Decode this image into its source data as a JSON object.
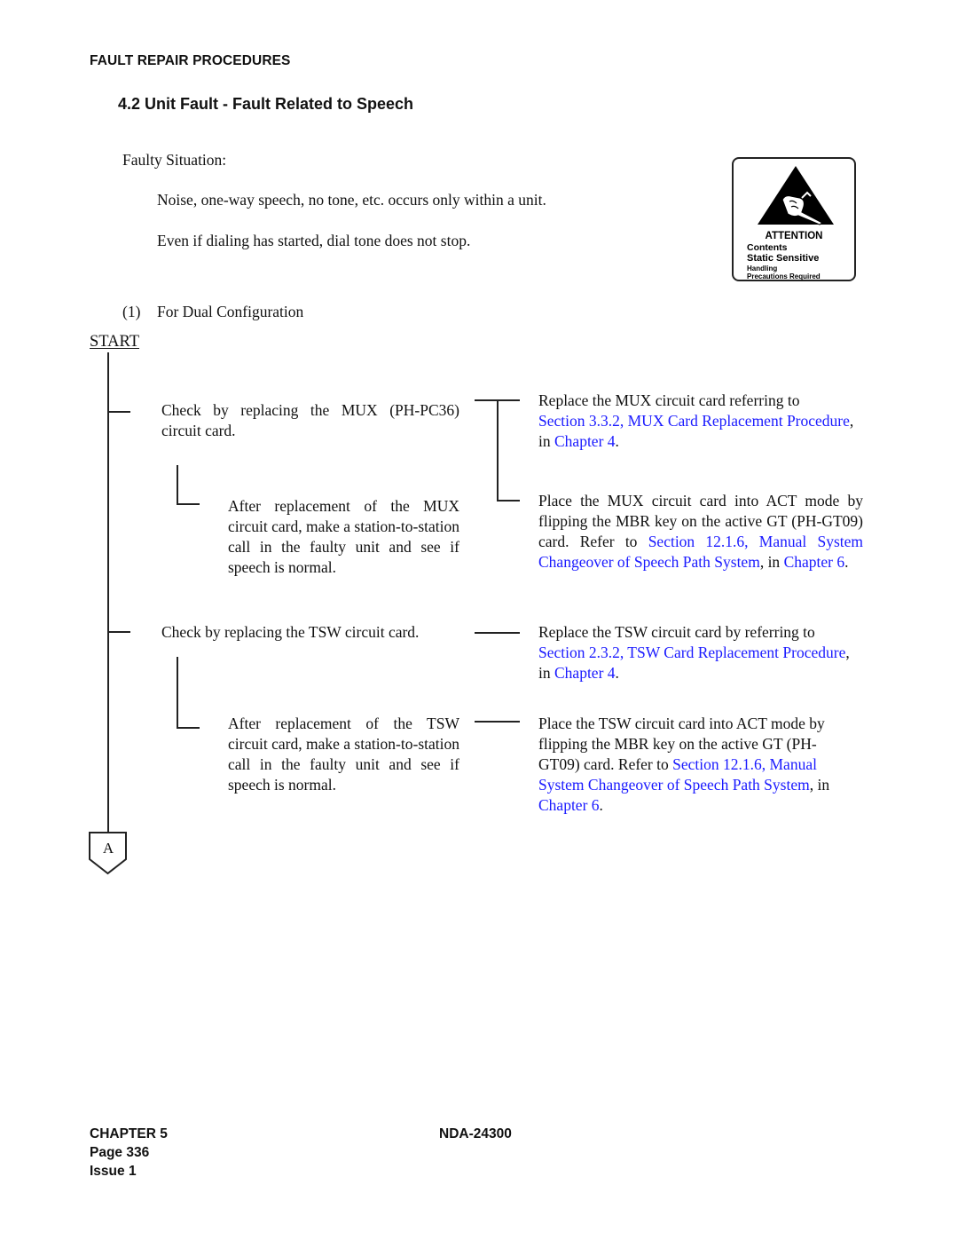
{
  "header": {
    "running_title": "FAULT REPAIR PROCEDURES"
  },
  "section": {
    "title": "4.2  Unit Fault - Fault Related to Speech"
  },
  "faulty_situation": {
    "label": "Faulty Situation:",
    "items": [
      "Noise, one-way speech, no tone, etc. occurs only within a unit.",
      "Even if dialing has started, dial tone does not stop."
    ]
  },
  "attention_badge": {
    "icon": "static-sensitive-hand-icon",
    "title": "ATTENTION",
    "line1": "Contents",
    "line2": "Static Sensitive",
    "line3": "Handling",
    "line4": "Precautions Required"
  },
  "config": {
    "number": "(1)",
    "label": "For Dual Configuration"
  },
  "flowchart": {
    "start_label": "START",
    "end_connector": "A",
    "steps": [
      {
        "check": "Check by replacing the MUX (PH-PC36) circuit card.",
        "after": "After replacement of the MUX circuit card, make a station-to-station call in the faulty unit and see if speech is normal.",
        "replace": {
          "prefix": "Replace the MUX circuit card referring to",
          "link1": "Section 3.3.2, MUX Card Replacement Procedure",
          "mid": ", in ",
          "link2": "Chapter 4",
          "suffix": "."
        },
        "place": {
          "prefix": "Place the MUX circuit card into ACT mode by flipping the MBR key on the active GT (PH-GT09) card. Refer to ",
          "link1": "Section 12.1.6, Manual System Changeover of Speech Path System",
          "mid": ", in ",
          "link2": "Chapter 6",
          "suffix": "."
        }
      },
      {
        "check": "Check by replacing the TSW circuit card.",
        "after": "After replacement of the TSW circuit card, make a station-to-station call in the faulty unit and see if speech is normal.",
        "replace": {
          "prefix": "Replace the TSW circuit card by referring to",
          "link1": "Section 2.3.2, TSW Card Replacement Procedure",
          "mid": ", in ",
          "link2": "Chapter 4",
          "suffix": "."
        },
        "place": {
          "prefix": "Place the TSW circuit card into ACT mode by flipping the MBR key on the active GT (PH-GT09) card. Refer to ",
          "link1": "Section 12.1.6, Manual System Changeover of Speech Path System",
          "mid": ", in ",
          "link2": "Chapter 6",
          "suffix": "."
        }
      }
    ]
  },
  "footer": {
    "chapter": "CHAPTER 5",
    "page": "Page 336",
    "issue": "Issue 1",
    "doc_number": "NDA-24300"
  },
  "colors": {
    "link": "#1a1aff",
    "text": "#111111"
  }
}
